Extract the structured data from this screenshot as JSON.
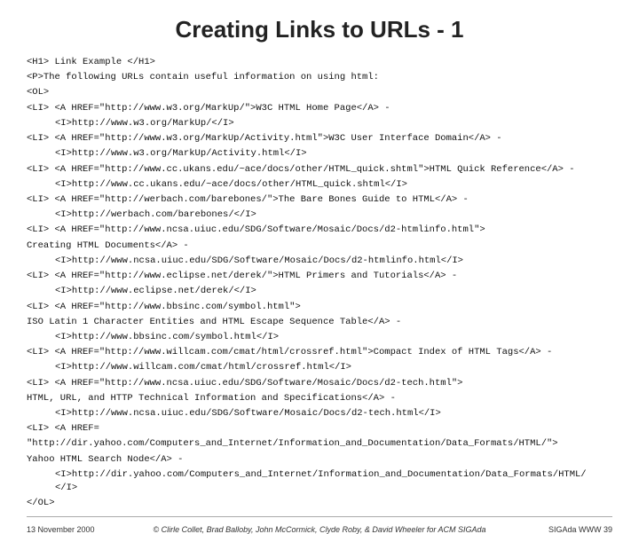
{
  "title": "Creating Links to URLs - 1",
  "content": {
    "lines": [
      {
        "text": "<H1> Link Example </H1>",
        "indent": 0
      },
      {
        "text": "",
        "indent": 0
      },
      {
        "text": "<P>The following URLs contain useful information on using html:",
        "indent": 0
      },
      {
        "text": "<OL>",
        "indent": 0
      },
      {
        "text": "<LI> <A HREF=\"http://www.w3.org/MarkUp/\">W3C HTML Home Page</A> -",
        "indent": 0
      },
      {
        "text": "<I>http://www.w3.org/MarkUp/</I>",
        "indent": 1
      },
      {
        "text": "<LI> <A HREF=\"http://www.w3.org/MarkUp/Activity.html\">W3C User Interface Domain</A> -",
        "indent": 0
      },
      {
        "text": "<I>http://www.w3.org/MarkUp/Activity.html</I>",
        "indent": 1
      },
      {
        "text": "<LI> <A HREF=\"http://www.cc.ukans.edu/~ace/docs/other/HTML_quick.shtml\">HTML Quick Reference</A> -",
        "indent": 0
      },
      {
        "text": "<I>http://www.cc.ukans.edu/~ace/docs/other/HTML_quick.shtml</I>",
        "indent": 1
      },
      {
        "text": "<LI> <A HREF=\"http://werbach.com/barebones/\">The Bare Bones Guide to HTML</A> -",
        "indent": 0
      },
      {
        "text": "<I>http://werbach.com/barebones/</I>",
        "indent": 1
      },
      {
        "text": "<LI> <A HREF=\"http://www.ncsa.uiuc.edu/SDG/Software/Mosaic/Docs/d2-htmlinfo.html\">",
        "indent": 0
      },
      {
        "text": "Creating HTML Documents</A> -",
        "indent": 0
      },
      {
        "text": "<I>http://www.ncsa.uiuc.edu/SDG/Software/Mosaic/Docs/d2-htmlinfo.html</I>",
        "indent": 1
      },
      {
        "text": "<LI> <A HREF=\"http://www.eclipse.net/derek/\">HTML Primers and Tutorials</A> -",
        "indent": 0
      },
      {
        "text": "<I>http://www.eclipse.net/derek/</I>",
        "indent": 1
      },
      {
        "text": "<LI> <A HREF=\"http://www.bbsinc.com/symbol.html\">",
        "indent": 0
      },
      {
        "text": "ISO Latin 1 Character Entities and HTML Escape Sequence Table</A> -",
        "indent": 0
      },
      {
        "text": "<I>http://www.bbsinc.com/symbol.html</I>",
        "indent": 1
      },
      {
        "text": "<LI> <A HREF=\"http://www.willcam.com/cmat/html/crossref.html\">Compact Index of HTML Tags</A> -",
        "indent": 0
      },
      {
        "text": "<I>http://www.willcam.com/cmat/html/crossref.html</I>",
        "indent": 1
      },
      {
        "text": "<LI> <A HREF=\"http://www.ncsa.uiuc.edu/SDG/Software/Mosaic/Docs/d2-tech.html\">",
        "indent": 0
      },
      {
        "text": "HTML, URL, and HTTP Technical Information and Specifications</A> -",
        "indent": 0
      },
      {
        "text": "<I>http://www.ncsa.uiuc.edu/SDG/Software/Mosaic/Docs/d2-tech.html</I>",
        "indent": 1
      },
      {
        "text": "<LI> <A HREF=",
        "indent": 0
      },
      {
        "text": "\"http://dir.yahoo.com/Computers_and_Internet/Information_and_Documentation/Data_Formats/HTML/\">",
        "indent": 0
      },
      {
        "text": "Yahoo HTML Search Node</A> -",
        "indent": 0
      },
      {
        "text": "<I>http://dir.yahoo.com/Computers_and_Internet/Information_and_Documentation/Data_Formats/HTML/ </I>",
        "indent": 1
      },
      {
        "text": "</OL>",
        "indent": 0
      }
    ]
  },
  "footer": {
    "left": "13 November 2000",
    "center": "© Clirle Collet, Brad Balloby, John McCormick, Clyde Roby, & David Wheeler for ACM SIGAda",
    "right": "SIGAda WWW 39"
  }
}
